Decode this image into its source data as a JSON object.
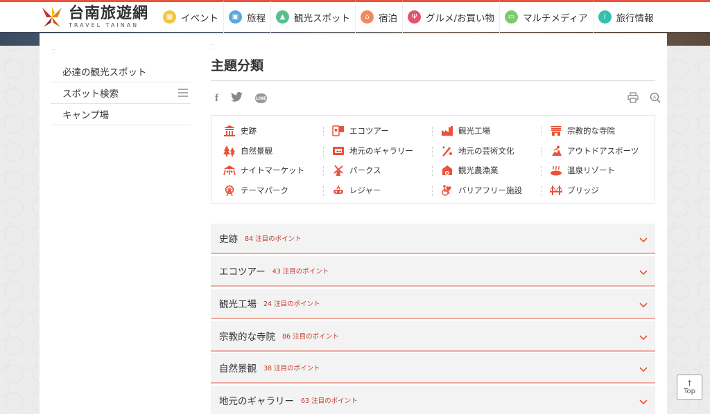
{
  "header": {
    "logo_title": "台南旅遊網",
    "logo_sub": "TRAVEL TAINAN",
    "nav": [
      {
        "label": "イベント",
        "icon": "calendar-icon",
        "color": "#f2c53d"
      },
      {
        "label": "旅程",
        "icon": "map-icon",
        "color": "#5aa6e0"
      },
      {
        "label": "観光スポット",
        "icon": "mountain-icon",
        "color": "#55c08a"
      },
      {
        "label": "宿泊",
        "icon": "house-icon",
        "color": "#f08a5d"
      },
      {
        "label": "グルメ/お買い物",
        "icon": "cutlery-icon",
        "color": "#e9506f"
      },
      {
        "label": "マルチメディア",
        "icon": "media-icon",
        "color": "#7ec96d"
      },
      {
        "label": "旅行情報",
        "icon": "info-icon",
        "color": "#33c2b0"
      }
    ]
  },
  "sidebar": {
    "items": [
      {
        "label": "必達の観光スポット"
      },
      {
        "label": "スポット検索"
      },
      {
        "label": "キャンプ場"
      }
    ]
  },
  "main": {
    "title": "主題分類",
    "share": {
      "facebook": "f",
      "line": "LINE"
    },
    "categories": [
      {
        "label": "史跡",
        "icon": "temple-icon"
      },
      {
        "label": "エコツアー",
        "icon": "eco-icon"
      },
      {
        "label": "観光工場",
        "icon": "factory-icon"
      },
      {
        "label": "宗教的な寺院",
        "icon": "shrine-icon"
      },
      {
        "label": "自然景観",
        "icon": "trees-icon"
      },
      {
        "label": "地元のギャラリー",
        "icon": "gallery-icon"
      },
      {
        "label": "地元の芸術文化",
        "icon": "art-icon"
      },
      {
        "label": "アウトドアスポーツ",
        "icon": "sports-icon"
      },
      {
        "label": "ナイトマーケット",
        "icon": "market-icon"
      },
      {
        "label": "パークス",
        "icon": "windmill-icon"
      },
      {
        "label": "観光農漁業",
        "icon": "farm-icon"
      },
      {
        "label": "温泉リゾート",
        "icon": "hotspring-icon"
      },
      {
        "label": "テーマパーク",
        "icon": "ferris-wheel-icon"
      },
      {
        "label": "レジャー",
        "icon": "leisure-icon"
      },
      {
        "label": "バリアフリー施設",
        "icon": "accessible-icon"
      },
      {
        "label": "ブリッジ",
        "icon": "bridge-icon"
      }
    ],
    "accordion": [
      {
        "title": "史跡",
        "count": "84 注目のポイント"
      },
      {
        "title": "エコツアー",
        "count": "43 注目のポイント"
      },
      {
        "title": "観光工場",
        "count": "24 注目のポイント"
      },
      {
        "title": "宗教的な寺院",
        "count": "86 注目のポイント"
      },
      {
        "title": "自然景観",
        "count": "38 注目のポイント"
      },
      {
        "title": "地元のギャラリー",
        "count": "63 注目のポイント"
      }
    ]
  },
  "top_button": {
    "label": "Top"
  },
  "colors": {
    "accent": "#e8533a",
    "count_red": "#c0392b"
  }
}
